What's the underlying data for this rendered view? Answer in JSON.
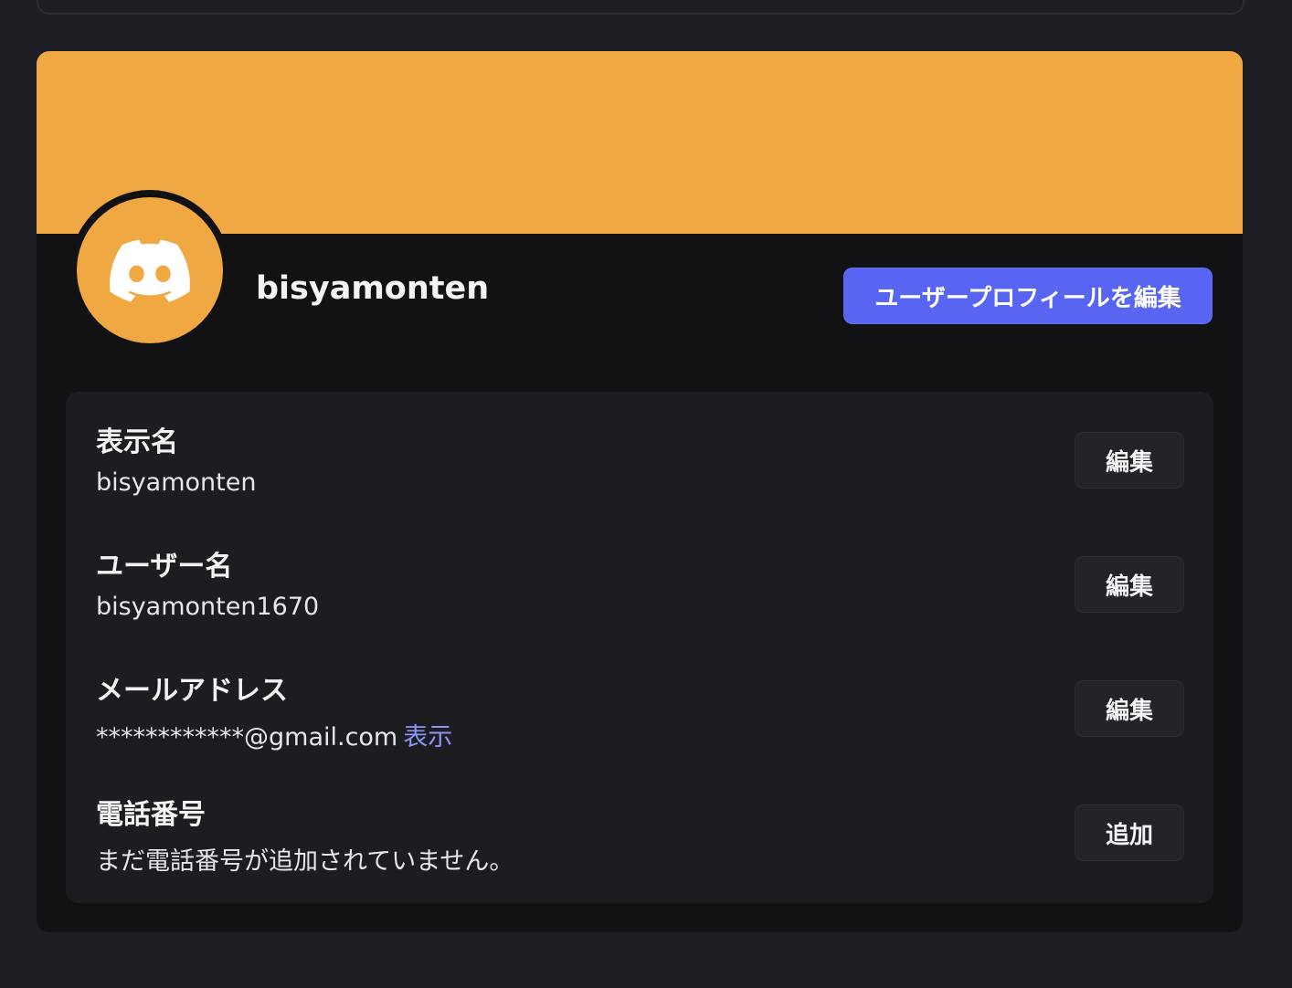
{
  "colors": {
    "banner": "#f0a843",
    "avatar_bg": "#f0a843",
    "brand_button": "#5865f2",
    "link": "#8d95f5"
  },
  "profile": {
    "username": "bisyamonten",
    "avatar_icon": "discord-logo-icon",
    "edit_profile_label": "ユーザープロフィールを編集"
  },
  "fields": [
    {
      "label": "表示名",
      "value": "bisyamonten",
      "button": "編集"
    },
    {
      "label": "ユーザー名",
      "value": "bisyamonten1670",
      "button": "編集"
    },
    {
      "label": "メールアドレス",
      "value": "************@gmail.com",
      "link": "表示",
      "button": "編集"
    },
    {
      "label": "電話番号",
      "value": "まだ電話番号が追加されていません。",
      "button": "追加"
    }
  ]
}
